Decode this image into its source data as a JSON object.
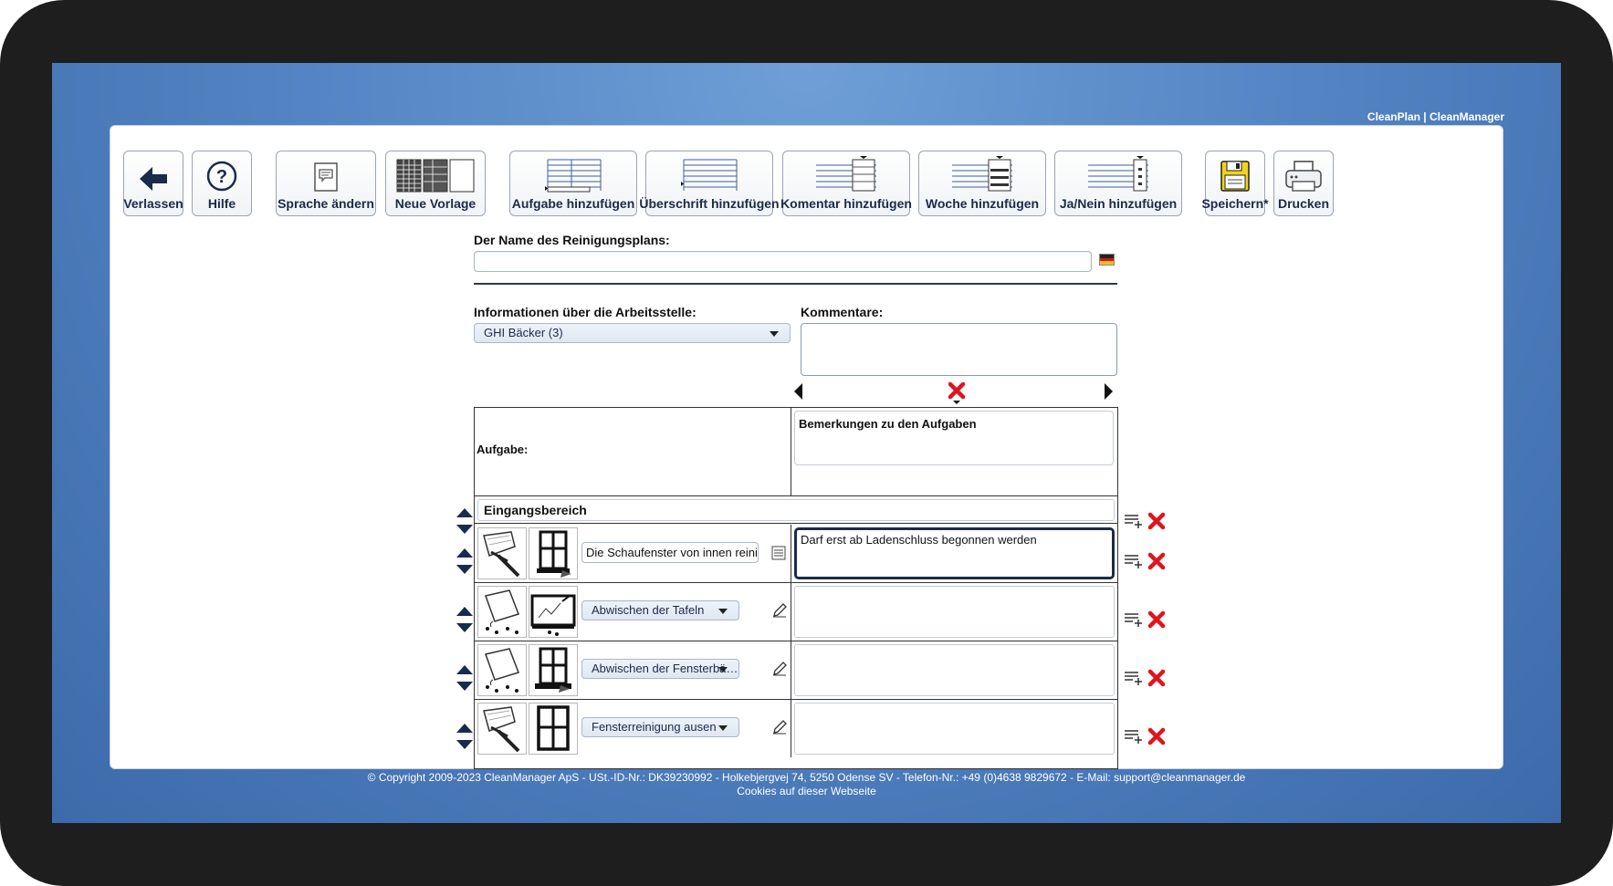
{
  "brand": "CleanPlan | CleanManager",
  "toolbar": {
    "leave": "Verlassen",
    "help": "Hilfe",
    "language": "Sprache ändern",
    "new_template": "Neue Vorlage",
    "add_task": "Aufgabe hinzufügen",
    "add_heading": "Überschrift hinzufügen",
    "add_comment": "Komentar hinzufügen",
    "add_week": "Woche hinzufügen",
    "add_yesno": "Ja/Nein hinzufügen",
    "save": "Speichern*",
    "print": "Drucken"
  },
  "form": {
    "plan_name_label": "Der Name des Reinigungsplans:",
    "plan_name_value": "",
    "workplace_label": "Informationen über die Arbeitsstelle:",
    "workplace_value": "GHI Bäcker (3)",
    "comments_label": "Kommentare:",
    "comments_value": ""
  },
  "table": {
    "task_header": "Aufgabe:",
    "remarks_header": "Bemerkungen zu den Aufgaben",
    "section_title": "Eingangsbereich",
    "rows": [
      {
        "task": "Die Schaufenster von innen reinig",
        "remark": "Darf erst ab Ladenschluss begonnen werden",
        "icon1": "squeegee-icon",
        "icon2": "window-icon",
        "type": "text"
      },
      {
        "task": "Abwischen der Tafeln",
        "remark": "",
        "icon1": "wet-cloth-icon",
        "icon2": "chalkboard-icon",
        "type": "select"
      },
      {
        "task": "Abwischen der Fensterbä…",
        "remark": "",
        "icon1": "wet-cloth-icon",
        "icon2": "window-sill-icon",
        "type": "select"
      },
      {
        "task": "Fensterreinigung ausen",
        "remark": "",
        "icon1": "squeegee-icon",
        "icon2": "window-frame-icon",
        "type": "select"
      }
    ]
  },
  "footer": {
    "copyright": "© Copyright 2009-2023 CleanManager ApS - USt.-ID-Nr.: DK39230992 - Holkebjergvej 74, 5250 Odense SV - Telefon-Nr.: +49 (0)4638 9829672 - E-Mail: support@cleanmanager.de",
    "cookies": "Cookies auf dieser Webseite"
  },
  "colors": {
    "background_blue": "#5585c4",
    "delete_red": "#e0141e",
    "navy": "#1a2a4a",
    "save_yellow": "#f3d21c"
  }
}
